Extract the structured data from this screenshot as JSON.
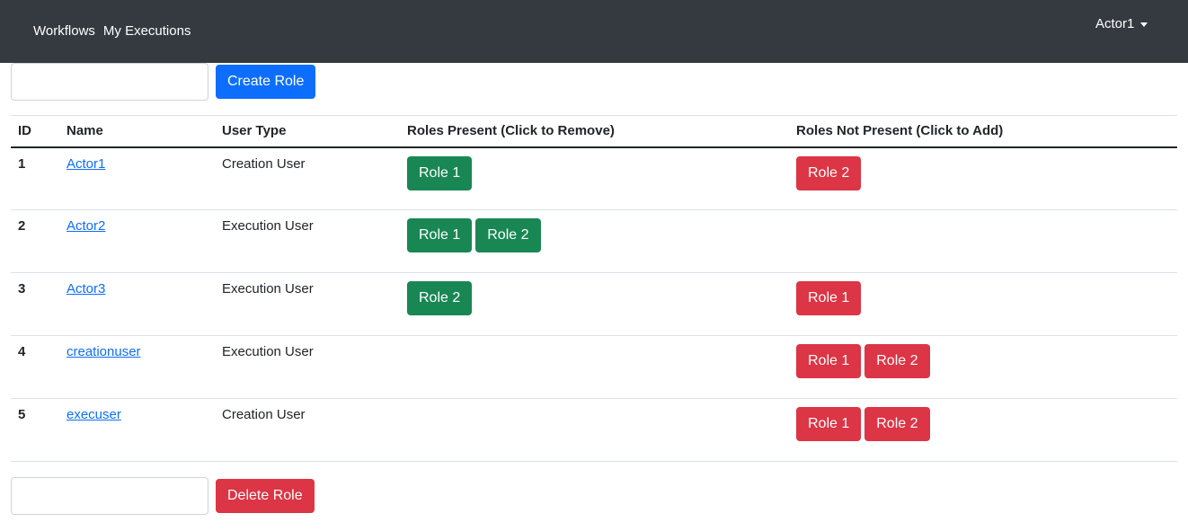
{
  "navbar": {
    "links": [
      "Workflows",
      "My Executions"
    ],
    "user": "Actor1"
  },
  "create_form": {
    "input_value": "",
    "button_label": "Create Role"
  },
  "table": {
    "headers": [
      "ID",
      "Name",
      "User Type",
      "Roles Present (Click to Remove)",
      "Roles Not Present (Click to Add)"
    ],
    "rows": [
      {
        "id": "1",
        "name": "Actor1",
        "user_type": "Creation User",
        "present": [
          "Role 1"
        ],
        "not_present": [
          "Role 2"
        ]
      },
      {
        "id": "2",
        "name": "Actor2",
        "user_type": "Execution User",
        "present": [
          "Role 1",
          "Role 2"
        ],
        "not_present": []
      },
      {
        "id": "3",
        "name": "Actor3",
        "user_type": "Execution User",
        "present": [
          "Role 2"
        ],
        "not_present": [
          "Role 1"
        ]
      },
      {
        "id": "4",
        "name": "creationuser",
        "user_type": "Execution User",
        "present": [],
        "not_present": [
          "Role 1",
          "Role 2"
        ]
      },
      {
        "id": "5",
        "name": "execuser",
        "user_type": "Creation User",
        "present": [],
        "not_present": [
          "Role 1",
          "Role 2"
        ]
      }
    ]
  },
  "delete_form": {
    "input_value": "",
    "button_label": "Delete Role"
  },
  "colors": {
    "navbar": "#343a40",
    "primary": "#0d6efd",
    "success": "#198754",
    "danger": "#dc3545"
  }
}
